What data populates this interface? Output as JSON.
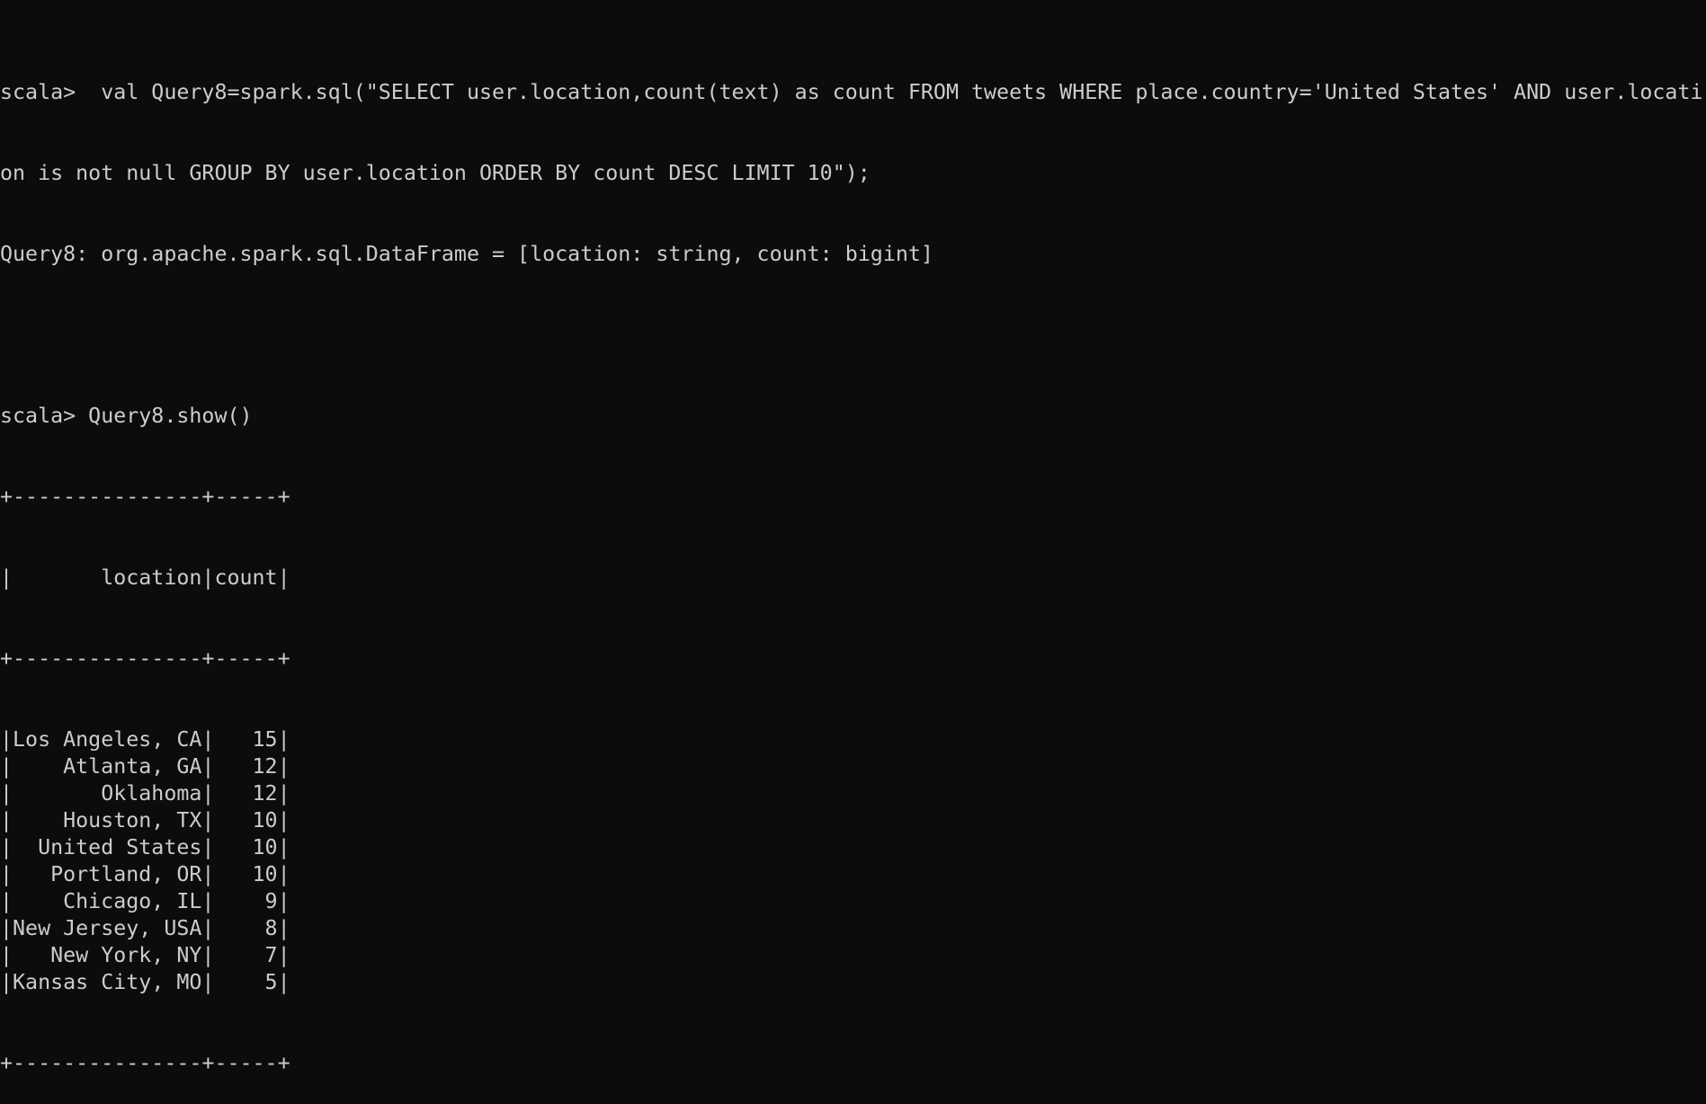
{
  "colors": {
    "background": "#0c0c0c",
    "foreground": "#cccccc"
  },
  "console": {
    "cmd1_line1": "scala>  val Query8=spark.sql(\"SELECT user.location,count(text) as count FROM tweets WHERE place.country='United States' AND user.locati",
    "cmd1_line2": "on is not null GROUP BY user.location ORDER BY count DESC LIMIT 10\");",
    "result1": "Query8: org.apache.spark.sql.DataFrame = [location: string, count: bigint]",
    "cmd2": "scala> Query8.show()"
  },
  "table": {
    "border": "+---------------+-----+",
    "sep": "|",
    "headers": {
      "location": "location",
      "count": "count"
    },
    "rows": [
      {
        "location": "Los Angeles, CA",
        "count": "15"
      },
      {
        "location": "Atlanta, GA",
        "count": "12"
      },
      {
        "location": "Oklahoma",
        "count": "12"
      },
      {
        "location": "Houston, TX",
        "count": "10"
      },
      {
        "location": "United States",
        "count": "10"
      },
      {
        "location": "Portland, OR",
        "count": "10"
      },
      {
        "location": "Chicago, IL",
        "count": "9"
      },
      {
        "location": "New Jersey, USA",
        "count": "8"
      },
      {
        "location": "New York, NY",
        "count": "7"
      },
      {
        "location": "Kansas City, MO",
        "count": "5"
      }
    ]
  }
}
